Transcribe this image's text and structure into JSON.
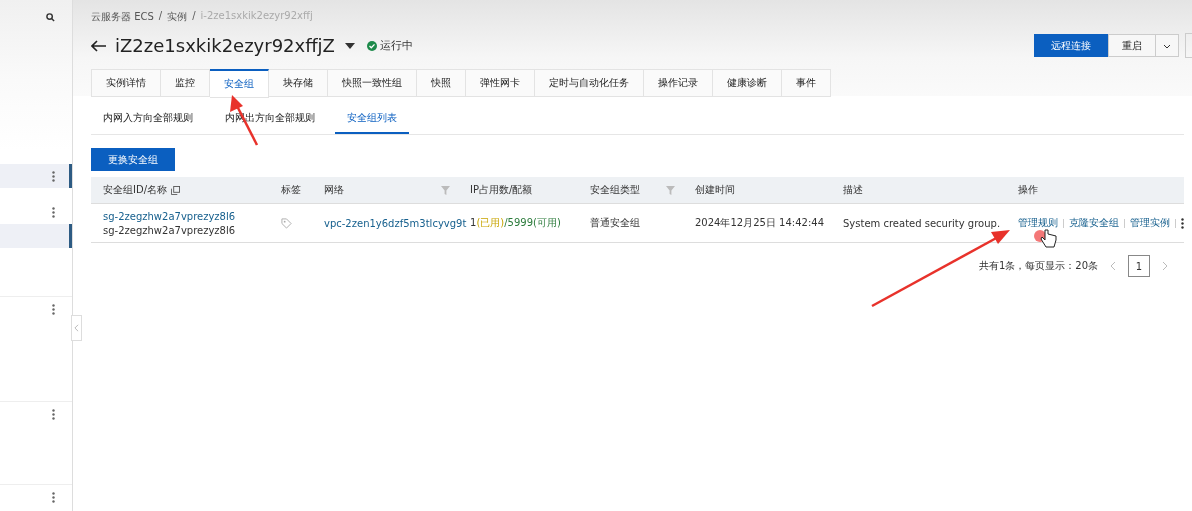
{
  "sidebar": {
    "items": [
      {
        "selected": true,
        "menu": true
      },
      {
        "selected": false,
        "menu": true
      },
      {
        "selected": true,
        "menu": false
      },
      {
        "selected": false,
        "menu": true
      },
      {
        "selected": false,
        "menu": true
      },
      {
        "selected": false,
        "menu": true
      }
    ]
  },
  "breadcrumb": [
    "云服务器 ECS",
    "实例",
    "i-2ze1sxkik2ezyr92xffj"
  ],
  "breadcrumb_separator": "/",
  "title": "iZ2ze1sxkik2ezyr92xffjZ",
  "status": "运行中",
  "header_buttons": [
    {
      "label": "远程连接",
      "kind": "primary"
    },
    {
      "label": "重启",
      "kind": "split"
    }
  ],
  "tabs": [
    {
      "label": "实例详情",
      "selected": false
    },
    {
      "label": "监控",
      "selected": false
    },
    {
      "label": "安全组",
      "selected": true
    },
    {
      "label": "块存储",
      "selected": false
    },
    {
      "label": "快照一致性组",
      "selected": false
    },
    {
      "label": "快照",
      "selected": false
    },
    {
      "label": "弹性网卡",
      "selected": false
    },
    {
      "label": "定时与自动化任务",
      "selected": false
    },
    {
      "label": "操作记录",
      "selected": false
    },
    {
      "label": "健康诊断",
      "selected": false
    },
    {
      "label": "事件",
      "selected": false
    }
  ],
  "subtabs": [
    {
      "label": "内网入方向全部规则",
      "selected": false
    },
    {
      "label": "内网出方向全部规则",
      "selected": false
    },
    {
      "label": "安全组列表",
      "selected": true
    }
  ],
  "action_button": "更换安全组",
  "table": {
    "columns": [
      {
        "label": "安全组ID/名称"
      },
      {
        "label": "标签"
      },
      {
        "label": "网络"
      },
      {
        "label": "IP占用数/配额"
      },
      {
        "label": "安全组类型"
      },
      {
        "label": "创建时间"
      },
      {
        "label": "描述"
      },
      {
        "label": "操作"
      }
    ],
    "rows": [
      {
        "id": "sg-2zegzhw2a7vprezyz8l6",
        "name": "sg-2zegzhw2a7vprezyz8l6",
        "network": "vpc-2zen1y6dzf5m3tlcyvg9t",
        "ip_used": "1",
        "ip_used_label": "(已用)",
        "ip_quota": "/5999(可用)",
        "type": "普通安全组",
        "created": "2024年12月25日 14:42:44",
        "description": "System created security group.",
        "actions": [
          "管理规则",
          "克隆安全组",
          "管理实例"
        ]
      }
    ]
  },
  "pagination": {
    "summary": "共有1条，每页显示：20条",
    "pages": [
      {
        "label": "1",
        "selected": true
      }
    ]
  }
}
